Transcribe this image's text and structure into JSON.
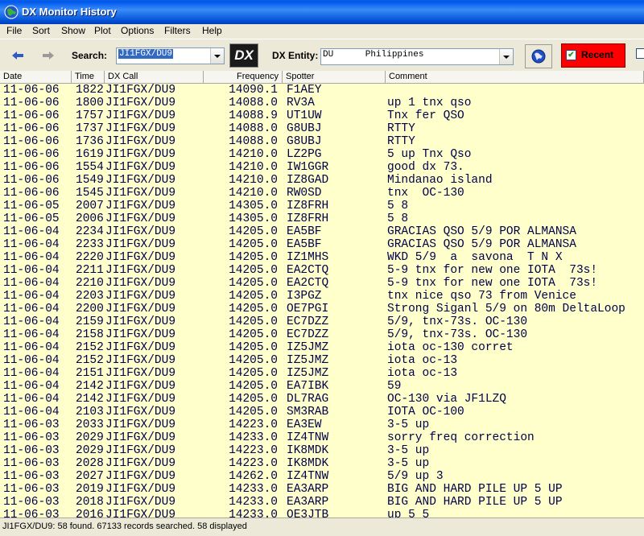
{
  "window": {
    "title": "DX Monitor History"
  },
  "menu": [
    {
      "label": "File"
    },
    {
      "label": "Sort"
    },
    {
      "label": "Show"
    },
    {
      "label": "Plot"
    },
    {
      "label": "Options"
    },
    {
      "label": "Filters"
    },
    {
      "label": "Help"
    }
  ],
  "toolbar": {
    "search_label": "Search:",
    "search_value": "JI1FGX/DU9",
    "dx_button": "DX",
    "entity_label": "DX Entity:",
    "entity_value": "DU      Philippines",
    "recent_label": "Recent",
    "recent_checked": "✔"
  },
  "columns": [
    "Date",
    "Time",
    "DX Call",
    "Frequency",
    "Spotter",
    "Comment"
  ],
  "rows": [
    {
      "date": "11-06-06",
      "time": "1822",
      "call": "JI1FGX/DU9",
      "freq": "14090.1",
      "spotter": "F1AEY",
      "comment": ""
    },
    {
      "date": "11-06-06",
      "time": "1800",
      "call": "JI1FGX/DU9",
      "freq": "14088.0",
      "spotter": "RV3A",
      "comment": "up 1 tnx qso"
    },
    {
      "date": "11-06-06",
      "time": "1757",
      "call": "JI1FGX/DU9",
      "freq": "14088.9",
      "spotter": "UT1UW",
      "comment": "Tnx fer QSO"
    },
    {
      "date": "11-06-06",
      "time": "1737",
      "call": "JI1FGX/DU9",
      "freq": "14088.0",
      "spotter": "G8UBJ",
      "comment": "RTTY"
    },
    {
      "date": "11-06-06",
      "time": "1736",
      "call": "JI1FGX/DU9",
      "freq": "14088.0",
      "spotter": "G8UBJ",
      "comment": "RTTY"
    },
    {
      "date": "11-06-06",
      "time": "1619",
      "call": "JI1FGX/DU9",
      "freq": "14210.0",
      "spotter": "LZ2PG",
      "comment": "5 up Tnx Qso"
    },
    {
      "date": "11-06-06",
      "time": "1554",
      "call": "JI1FGX/DU9",
      "freq": "14210.0",
      "spotter": "IW1GGR",
      "comment": "good dx 73."
    },
    {
      "date": "11-06-06",
      "time": "1549",
      "call": "JI1FGX/DU9",
      "freq": "14210.0",
      "spotter": "IZ8GAD",
      "comment": "Mindanao island"
    },
    {
      "date": "11-06-06",
      "time": "1545",
      "call": "JI1FGX/DU9",
      "freq": "14210.0",
      "spotter": "RW0SD",
      "comment": "tnx  OC-130"
    },
    {
      "date": "11-06-05",
      "time": "2007",
      "call": "JI1FGX/DU9",
      "freq": "14305.0",
      "spotter": "IZ8FRH",
      "comment": "5 8"
    },
    {
      "date": "11-06-05",
      "time": "2006",
      "call": "JI1FGX/DU9",
      "freq": "14305.0",
      "spotter": "IZ8FRH",
      "comment": "5 8"
    },
    {
      "date": "11-06-04",
      "time": "2234",
      "call": "JI1FGX/DU9",
      "freq": "14205.0",
      "spotter": "EA5BF",
      "comment": "GRACIAS QSO 5/9 POR ALMANSA"
    },
    {
      "date": "11-06-04",
      "time": "2233",
      "call": "JI1FGX/DU9",
      "freq": "14205.0",
      "spotter": "EA5BF",
      "comment": "GRACIAS QSO 5/9 POR ALMANSA"
    },
    {
      "date": "11-06-04",
      "time": "2220",
      "call": "JI1FGX/DU9",
      "freq": "14205.0",
      "spotter": "IZ1MHS",
      "comment": "WKD 5/9  a  savona  T N X"
    },
    {
      "date": "11-06-04",
      "time": "2211",
      "call": "JI1FGX/DU9",
      "freq": "14205.0",
      "spotter": "EA2CTQ",
      "comment": "5-9 tnx for new one IOTA  73s!"
    },
    {
      "date": "11-06-04",
      "time": "2210",
      "call": "JI1FGX/DU9",
      "freq": "14205.0",
      "spotter": "EA2CTQ",
      "comment": "5-9 tnx for new one IOTA  73s!"
    },
    {
      "date": "11-06-04",
      "time": "2203",
      "call": "JI1FGX/DU9",
      "freq": "14205.0",
      "spotter": "I3PGZ",
      "comment": "tnx nice qso 73 from Venice"
    },
    {
      "date": "11-06-04",
      "time": "2200",
      "call": "JI1FGX/DU9",
      "freq": "14205.0",
      "spotter": "OE7PGI",
      "comment": "Strong Siganl 5/9 on 80m DeltaLoop"
    },
    {
      "date": "11-06-04",
      "time": "2159",
      "call": "JI1FGX/DU9",
      "freq": "14205.0",
      "spotter": "EC7DZZ",
      "comment": "5/9, tnx-73s. OC-130"
    },
    {
      "date": "11-06-04",
      "time": "2158",
      "call": "JI1FGX/DU9",
      "freq": "14205.0",
      "spotter": "EC7DZZ",
      "comment": "5/9, tnx-73s. OC-130"
    },
    {
      "date": "11-06-04",
      "time": "2152",
      "call": "JI1FGX/DU9",
      "freq": "14205.0",
      "spotter": "IZ5JMZ",
      "comment": "iota oc-130 corret"
    },
    {
      "date": "11-06-04",
      "time": "2152",
      "call": "JI1FGX/DU9",
      "freq": "14205.0",
      "spotter": "IZ5JMZ",
      "comment": "iota oc-13"
    },
    {
      "date": "11-06-04",
      "time": "2151",
      "call": "JI1FGX/DU9",
      "freq": "14205.0",
      "spotter": "IZ5JMZ",
      "comment": "iota oc-13"
    },
    {
      "date": "11-06-04",
      "time": "2142",
      "call": "JI1FGX/DU9",
      "freq": "14205.0",
      "spotter": "EA7IBK",
      "comment": "59"
    },
    {
      "date": "11-06-04",
      "time": "2142",
      "call": "JI1FGX/DU9",
      "freq": "14205.0",
      "spotter": "DL7RAG",
      "comment": "OC-130 via JF1LZQ"
    },
    {
      "date": "11-06-04",
      "time": "2103",
      "call": "JI1FGX/DU9",
      "freq": "14205.0",
      "spotter": "SM3RAB",
      "comment": "IOTA OC-100"
    },
    {
      "date": "11-06-03",
      "time": "2033",
      "call": "JI1FGX/DU9",
      "freq": "14223.0",
      "spotter": "EA3EW",
      "comment": "3-5 up"
    },
    {
      "date": "11-06-03",
      "time": "2029",
      "call": "JI1FGX/DU9",
      "freq": "14233.0",
      "spotter": "IZ4TNW",
      "comment": "sorry freq correction"
    },
    {
      "date": "11-06-03",
      "time": "2029",
      "call": "JI1FGX/DU9",
      "freq": "14223.0",
      "spotter": "IK8MDK",
      "comment": "3-5 up"
    },
    {
      "date": "11-06-03",
      "time": "2028",
      "call": "JI1FGX/DU9",
      "freq": "14223.0",
      "spotter": "IK8MDK",
      "comment": "3-5 up"
    },
    {
      "date": "11-06-03",
      "time": "2027",
      "call": "JI1FGX/DU9",
      "freq": "14262.0",
      "spotter": "IZ4TNW",
      "comment": "5/9 up 3"
    },
    {
      "date": "11-06-03",
      "time": "2019",
      "call": "JI1FGX/DU9",
      "freq": "14233.0",
      "spotter": "EA3ARP",
      "comment": "BIG AND HARD PILE UP 5 UP"
    },
    {
      "date": "11-06-03",
      "time": "2018",
      "call": "JI1FGX/DU9",
      "freq": "14233.0",
      "spotter": "EA3ARP",
      "comment": "BIG AND HARD PILE UP 5 UP"
    },
    {
      "date": "11-06-03",
      "time": "2016",
      "call": "JI1FGX/DU9",
      "freq": "14233.0",
      "spotter": "OE3JTB",
      "comment": "up 5 5"
    }
  ],
  "status": {
    "text": "JI1FGX/DU9: 58 found.  67133 records searched.  58 displayed"
  }
}
